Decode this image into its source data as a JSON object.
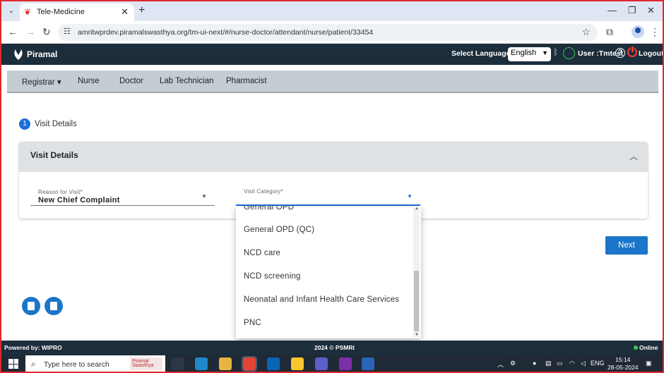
{
  "browser": {
    "tab_title": "Tele-Medicine",
    "url": "amritwprdev.piramalswasthya.org/tm-ui-next/#/nurse-doctor/attendant/nurse/patient/33454"
  },
  "header": {
    "brand": "Piramal",
    "select_language_label": "Select Language:",
    "language_value": "English",
    "user_label": "User :Tmtest",
    "logout_label": "Logout"
  },
  "menu": {
    "items": [
      "Registrar",
      "Nurse",
      "Doctor",
      "Lab Technician",
      "Pharmacist"
    ]
  },
  "stepper": {
    "step_number": "1",
    "step_label": "Visit Details"
  },
  "card": {
    "title": "Visit Details",
    "reason_label": "Reason for Visit*",
    "reason_value": "New Chief Complaint",
    "category_label": "Visit Category*",
    "category_value": ""
  },
  "dropdown": {
    "options": [
      "General OPD",
      "General OPD (QC)",
      "NCD care",
      "NCD screening",
      "Neonatal and Infant Health Care Services",
      "PNC"
    ]
  },
  "actions": {
    "next_label": "Next"
  },
  "footer": {
    "powered_by": "Powered by: WIPRO",
    "copyright": "2024 © PSMRI",
    "status": "Online"
  },
  "taskbar": {
    "search_placeholder": "Type here to search",
    "search_badge": "Piramal Swasthya",
    "language": "ENG",
    "time": "15:14",
    "date": "28-05-2024"
  },
  "colors": {
    "accent_blue": "#1b75c8",
    "header_dark": "#1c2d3b",
    "menu_bg": "#c5cdd3",
    "online_green": "#34c759",
    "logout_red": "#ff3b30"
  }
}
